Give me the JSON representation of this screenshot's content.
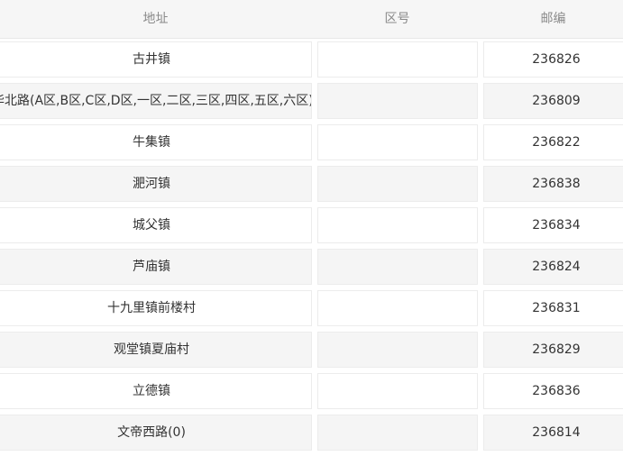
{
  "headers": {
    "address": "地址",
    "area_code": "区号",
    "zip": "邮编"
  },
  "rows": [
    {
      "address": "古井镇",
      "area_code": "",
      "zip": "236826"
    },
    {
      "address": "华北路(A区,B区,C区,D区,一区,二区,三区,四区,五区,六区)",
      "area_code": "",
      "zip": "236809"
    },
    {
      "address": "牛集镇",
      "area_code": "",
      "zip": "236822"
    },
    {
      "address": "淝河镇",
      "area_code": "",
      "zip": "236838"
    },
    {
      "address": "城父镇",
      "area_code": "",
      "zip": "236834"
    },
    {
      "address": "芦庙镇",
      "area_code": "",
      "zip": "236824"
    },
    {
      "address": "十九里镇前楼村",
      "area_code": "",
      "zip": "236831"
    },
    {
      "address": "观堂镇夏庙村",
      "area_code": "",
      "zip": "236829"
    },
    {
      "address": "立德镇",
      "area_code": "",
      "zip": "236836"
    },
    {
      "address": "文帝西路(0)",
      "area_code": "",
      "zip": "236814"
    }
  ]
}
